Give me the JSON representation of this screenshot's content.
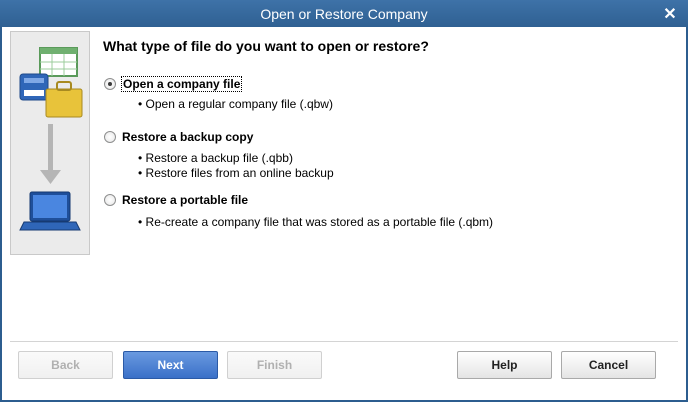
{
  "window": {
    "title": "Open or Restore Company"
  },
  "question": "What type of file do you want to open or restore?",
  "options": [
    {
      "label": "Open a company file",
      "selected": true,
      "bullets": [
        "• Open a regular company file (.qbw)"
      ]
    },
    {
      "label": "Restore a backup copy",
      "selected": false,
      "bullets": [
        "• Restore a backup file (.qbb)",
        "• Restore files from an online backup"
      ]
    },
    {
      "label": "Restore a portable file",
      "selected": false,
      "bullets": [
        "• Re-create a company file that was stored as a portable file (.qbm)"
      ]
    }
  ],
  "buttons": {
    "back": "Back",
    "next": "Next",
    "finish": "Finish",
    "help": "Help",
    "cancel": "Cancel"
  },
  "icons": {
    "close": "close-icon",
    "illustration": [
      "spreadsheet-icon",
      "database-icon",
      "briefcase-icon",
      "arrow-down-icon",
      "laptop-icon"
    ]
  },
  "colors": {
    "titlebar": "#2f6092",
    "primary_button": "#3a70c8"
  }
}
